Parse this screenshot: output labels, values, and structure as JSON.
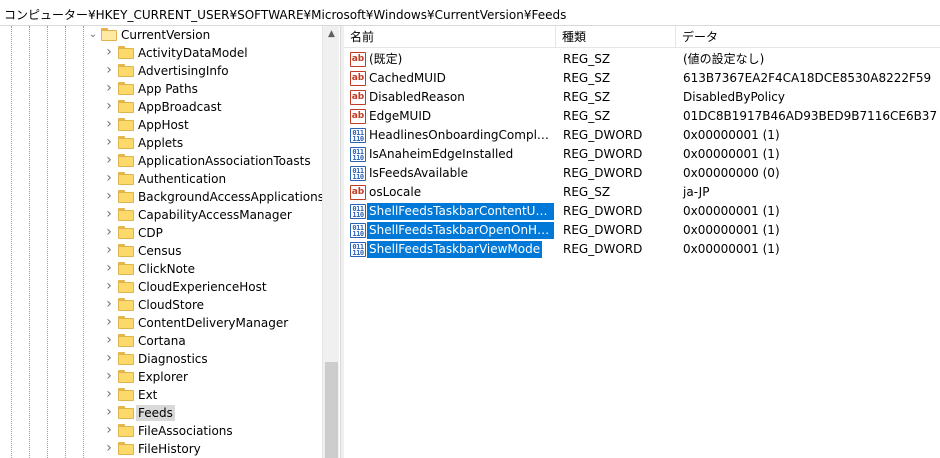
{
  "address": "コンピューター¥HKEY_CURRENT_USER¥SOFTWARE¥Microsoft¥Windows¥CurrentVersion¥Feeds",
  "tree": {
    "parent": {
      "label": "CurrentVersion",
      "expanded": true
    },
    "items": [
      {
        "label": "ActivityDataModel"
      },
      {
        "label": "AdvertisingInfo"
      },
      {
        "label": "App Paths"
      },
      {
        "label": "AppBroadcast"
      },
      {
        "label": "AppHost"
      },
      {
        "label": "Applets"
      },
      {
        "label": "ApplicationAssociationToasts"
      },
      {
        "label": "Authentication"
      },
      {
        "label": "BackgroundAccessApplications"
      },
      {
        "label": "CapabilityAccessManager"
      },
      {
        "label": "CDP"
      },
      {
        "label": "Census"
      },
      {
        "label": "ClickNote"
      },
      {
        "label": "CloudExperienceHost"
      },
      {
        "label": "CloudStore"
      },
      {
        "label": "ContentDeliveryManager"
      },
      {
        "label": "Cortana"
      },
      {
        "label": "Diagnostics"
      },
      {
        "label": "Explorer"
      },
      {
        "label": "Ext"
      },
      {
        "label": "Feeds",
        "selected": true
      },
      {
        "label": "FileAssociations"
      },
      {
        "label": "FileHistory"
      }
    ]
  },
  "columns": {
    "name": "名前",
    "type": "種類",
    "data": "データ"
  },
  "values": [
    {
      "icon": "string-value-icon",
      "name": "(既定)",
      "type": "REG_SZ",
      "data": "(値の設定なし)"
    },
    {
      "icon": "string-value-icon",
      "name": "CachedMUID",
      "type": "REG_SZ",
      "data": "613B7367EA2F4CA18DCE8530A8222F59"
    },
    {
      "icon": "string-value-icon",
      "name": "DisabledReason",
      "type": "REG_SZ",
      "data": "DisabledByPolicy"
    },
    {
      "icon": "string-value-icon",
      "name": "EdgeMUID",
      "type": "REG_SZ",
      "data": "01DC8B1917B46AD93BED9B7116CE6B37"
    },
    {
      "icon": "dword-value-icon",
      "name": "HeadlinesOnboardingComplete",
      "type": "REG_DWORD",
      "data": "0x00000001 (1)"
    },
    {
      "icon": "dword-value-icon",
      "name": "IsAnaheimEdgeInstalled",
      "type": "REG_DWORD",
      "data": "0x00000001 (1)"
    },
    {
      "icon": "dword-value-icon",
      "name": "IsFeedsAvailable",
      "type": "REG_DWORD",
      "data": "0x00000000 (0)"
    },
    {
      "icon": "string-value-icon",
      "name": "osLocale",
      "type": "REG_SZ",
      "data": "ja-JP"
    },
    {
      "icon": "dword-value-icon",
      "name": "ShellFeedsTaskbarContentUpdate...",
      "type": "REG_DWORD",
      "data": "0x00000001 (1)",
      "selected": true
    },
    {
      "icon": "dword-value-icon",
      "name": "ShellFeedsTaskbarOpenOnHover",
      "type": "REG_DWORD",
      "data": "0x00000001 (1)",
      "selected": true
    },
    {
      "icon": "dword-value-icon",
      "name": "ShellFeedsTaskbarViewMode",
      "type": "REG_DWORD",
      "data": "0x00000001 (1)",
      "selected": true
    }
  ],
  "icons": {
    "string_glyph": "ab",
    "dword_glyph": "011 110"
  },
  "colors": {
    "selection": "#0078d7",
    "tree_selection": "#d9d9d9",
    "folder": "#fcd96b",
    "string_icon": "#c23b22",
    "dword_icon": "#2b62b5"
  }
}
